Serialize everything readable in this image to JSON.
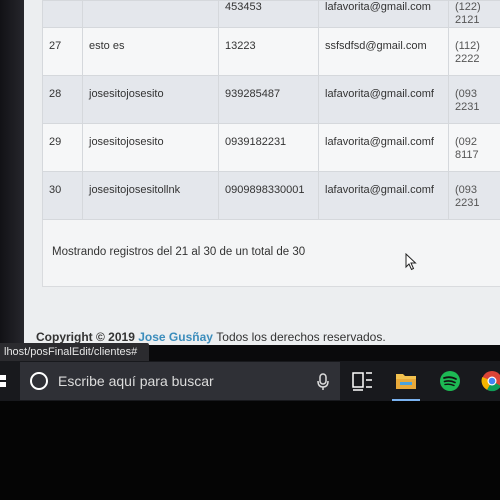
{
  "table": {
    "rows": [
      {
        "id": "",
        "name": "",
        "ci": "453453",
        "email": "lafavorita@gmail.com",
        "tel1": "(122)",
        "tel2": "2121"
      },
      {
        "id": "27",
        "name": "esto es",
        "ci": "13223",
        "email": "ssfsdfsd@gmail.com",
        "tel1": "(112)",
        "tel2": "2222"
      },
      {
        "id": "28",
        "name": "josesitojosesito",
        "ci": "939285487",
        "email": "lafavorita@gmail.comf",
        "tel1": "(093",
        "tel2": "2231"
      },
      {
        "id": "29",
        "name": "josesitojosesito",
        "ci": "0939182231",
        "email": "lafavorita@gmail.comf",
        "tel1": "(092",
        "tel2": "8117"
      },
      {
        "id": "30",
        "name": "josesitojosesitollnk",
        "ci": "0909898330001",
        "email": "lafavorita@gmail.comf",
        "tel1": "(093",
        "tel2": "2231"
      }
    ]
  },
  "info": "Mostrando registros del 21 al 30 de un total de 30",
  "footer": {
    "copyright": "Copyright © 2019",
    "author": "Jose Gusñay",
    "rights": "Todos los derechos reservados."
  },
  "status_url": "lhost/posFinalEdit/clientes#",
  "taskbar": {
    "search_placeholder": "Escribe aquí para buscar",
    "icons": [
      "task-view-icon",
      "file-explorer-icon",
      "spotify-icon",
      "chrome-icon"
    ]
  }
}
